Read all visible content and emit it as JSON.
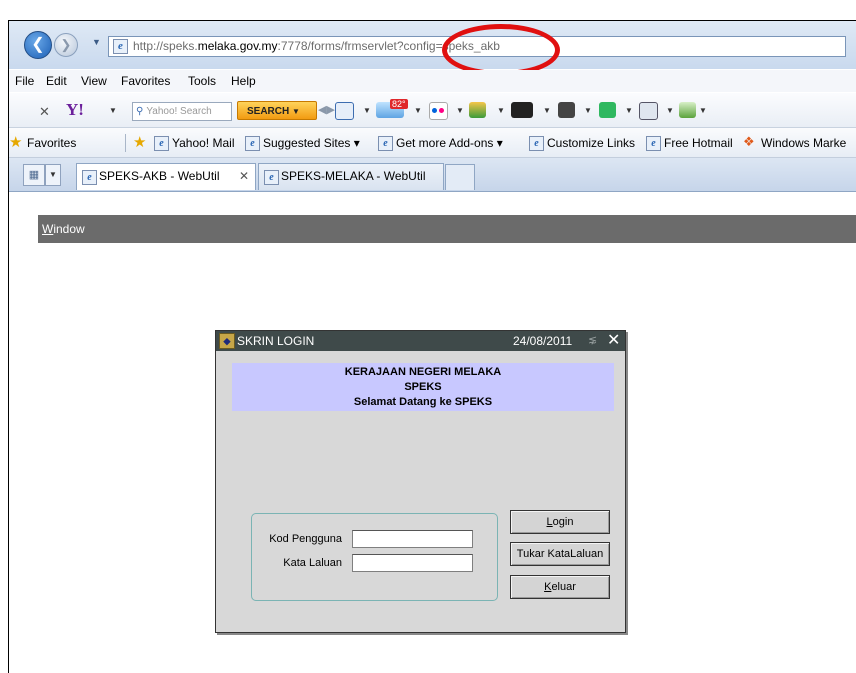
{
  "browser": {
    "url_prefix": "http://speks.",
    "url_host": "melaka.gov.my",
    "url_suffix": ":7778/forms/frmservlet?config=speks_akb",
    "menu": [
      "File",
      "Edit",
      "View",
      "Favorites",
      "Tools",
      "Help"
    ],
    "yahoo_toolbar": {
      "logo": "Y!",
      "search_placeholder": "Yahoo! Search",
      "search_button": "SEARCH",
      "weather_badge": "82°"
    },
    "favorites_bar": {
      "favorites_label": "Favorites",
      "items": [
        "Yahoo! Mail",
        "Suggested Sites ▾",
        "Get more Add-ons ▾",
        "Customize Links",
        "Free Hotmail",
        "Windows Marke"
      ]
    },
    "tabs": [
      {
        "label": "SPEKS-AKB - WebUtil",
        "active": true
      },
      {
        "label": "SPEKS-MELAKA - WebUtil",
        "active": false
      }
    ]
  },
  "app": {
    "menu_label_prefix": "W",
    "menu_label_rest": "indow"
  },
  "dialog": {
    "title": "SKRIN LOGIN",
    "date": "24/08/2011",
    "banner": {
      "line1": "KERAJAAN NEGERI MELAKA",
      "line2": "SPEKS",
      "line3": "Selamat Datang ke SPEKS"
    },
    "fields": {
      "user_label": "Kod Pengguna",
      "user_value": "",
      "password_label": "Kata Laluan",
      "password_value": ""
    },
    "buttons": {
      "login_prefix": "",
      "login_ul": "L",
      "login_rest": "ogin",
      "change_password": "Tukar KataLaluan",
      "exit_ul": "K",
      "exit_rest": "eluar"
    }
  },
  "colors": {
    "annotation_circle": "#e01010",
    "banner_bg": "#c8c8ff",
    "title_bar": "#3f4a4a",
    "app_bar": "#6b6b6b"
  }
}
